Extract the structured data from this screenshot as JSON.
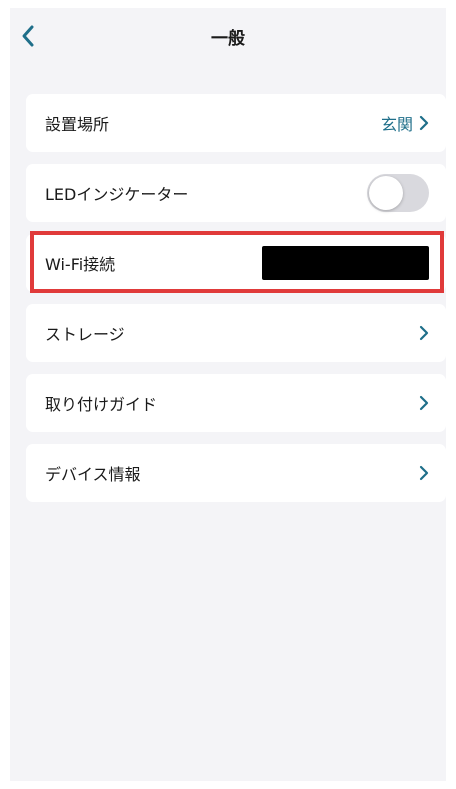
{
  "header": {
    "title": "一般",
    "back_icon": "chevron-left-icon"
  },
  "colors": {
    "accent": "#1f6f8a",
    "background": "#f4f4f7",
    "highlight": "#e03a3a",
    "toggle_off": "#d9d9de"
  },
  "settings": {
    "location": {
      "label": "設置場所",
      "value": "玄関",
      "icon": "chevron-right-icon"
    },
    "led": {
      "label": "LEDインジケーター",
      "toggle_on": false
    },
    "wifi": {
      "label": "Wi-Fi接続",
      "value_redacted": true
    },
    "storage": {
      "label": "ストレージ",
      "icon": "chevron-right-icon"
    },
    "install_guide": {
      "label": "取り付けガイド",
      "icon": "chevron-right-icon"
    },
    "device_info": {
      "label": "デバイス情報",
      "icon": "chevron-right-icon"
    }
  }
}
